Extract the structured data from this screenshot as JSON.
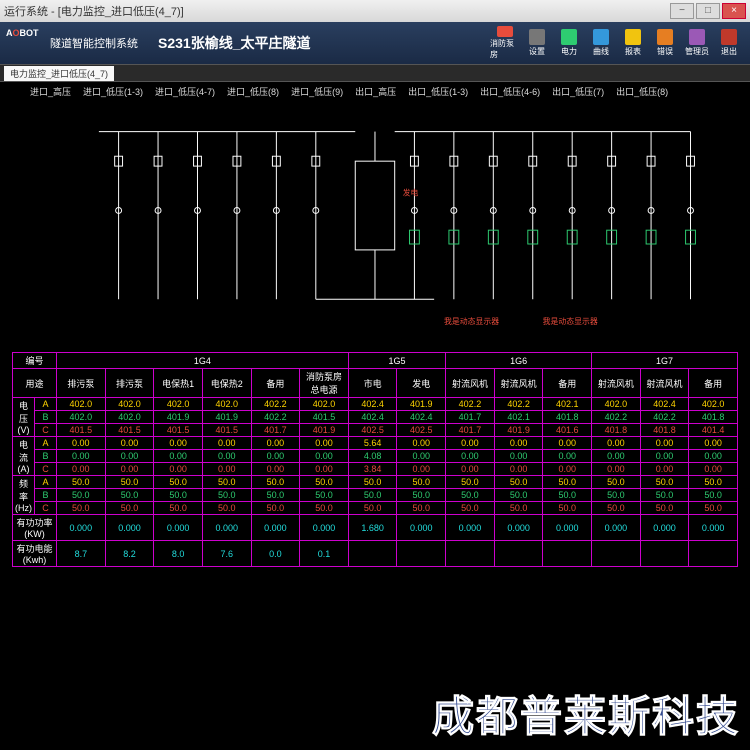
{
  "window": {
    "title": "运行系统 - [电力监控_进口低压(4_7)]"
  },
  "header": {
    "logo1": "A",
    "logoO": "O",
    "logo2": "BOT",
    "sysname": "隧道智能控制系统",
    "linetitle": "S231张榆线_太平庄隧道"
  },
  "toolbar": [
    {
      "lbl": "消防泵房",
      "c": "#e74c3c"
    },
    {
      "lbl": "设置",
      "c": "#777"
    },
    {
      "lbl": "电力",
      "c": "#2ecc71"
    },
    {
      "lbl": "曲线",
      "c": "#3498db"
    },
    {
      "lbl": "报表",
      "c": "#f1c40f"
    },
    {
      "lbl": "错误",
      "c": "#e67e22"
    },
    {
      "lbl": "管理员",
      "c": "#9b59b6"
    },
    {
      "lbl": "退出",
      "c": "#c0392b"
    }
  ],
  "tab": "电力监控_进口低压(4_7)",
  "subtabs": [
    "进口_高压",
    "进口_低压(1-3)",
    "进口_低压(4-7)",
    "进口_低压(8)",
    "进口_低压(9)",
    "出口_高压",
    "出口_低压(1-3)",
    "出口_低压(4-6)",
    "出口_低压(7)",
    "出口_低压(8)"
  ],
  "diagram": {
    "label1": "发电",
    "label2": "我是动态显示器",
    "label3": "我是动态显示器"
  },
  "table": {
    "hdr_id": "编号",
    "hdr_use": "用途",
    "hdr_v": "电压",
    "hdr_v2": "(V)",
    "hdr_i": "电流",
    "hdr_i2": "(A)",
    "hdr_f": "频率",
    "hdr_f2": "(Hz)",
    "hdr_p": "有功功率(KW)",
    "hdr_e": "有功电能(Kwh)",
    "groups": [
      "1G4",
      "1G5",
      "1G6",
      "1G7"
    ],
    "uses": [
      "排污泵",
      "排污泵",
      "电保热1",
      "电保热2",
      "备用",
      "消防泵房总电源",
      "市电",
      "发电",
      "射流风机",
      "射流风机",
      "备用",
      "射流风机",
      "射流风机",
      "备用"
    ],
    "vA": [
      "402.0",
      "402.0",
      "402.0",
      "402.0",
      "402.2",
      "402.0",
      "402.4",
      "401.9",
      "402.2",
      "402.2",
      "402.1",
      "402.0",
      "402.4",
      "402.0"
    ],
    "vB": [
      "402.0",
      "402.0",
      "401.9",
      "401.9",
      "402.2",
      "401.5",
      "402.4",
      "402.4",
      "401.7",
      "402.1",
      "401.8",
      "402.2",
      "402.2",
      "401.8"
    ],
    "vC": [
      "401.5",
      "401.5",
      "401.5",
      "401.5",
      "401.7",
      "401.9",
      "402.5",
      "402.5",
      "401.7",
      "401.9",
      "401.6",
      "401.8",
      "401.8",
      "401.4"
    ],
    "iA": [
      "0.00",
      "0.00",
      "0.00",
      "0.00",
      "0.00",
      "0.00",
      "5.64",
      "0.00",
      "0.00",
      "0.00",
      "0.00",
      "0.00",
      "0.00",
      "0.00"
    ],
    "iB": [
      "0.00",
      "0.00",
      "0.00",
      "0.00",
      "0.00",
      "0.00",
      "4.08",
      "0.00",
      "0.00",
      "0.00",
      "0.00",
      "0.00",
      "0.00",
      "0.00"
    ],
    "iC": [
      "0.00",
      "0.00",
      "0.00",
      "0.00",
      "0.00",
      "0.00",
      "3.84",
      "0.00",
      "0.00",
      "0.00",
      "0.00",
      "0.00",
      "0.00",
      "0.00"
    ],
    "fA": [
      "50.0",
      "50.0",
      "50.0",
      "50.0",
      "50.0",
      "50.0",
      "50.0",
      "50.0",
      "50.0",
      "50.0",
      "50.0",
      "50.0",
      "50.0",
      "50.0"
    ],
    "fB": [
      "50.0",
      "50.0",
      "50.0",
      "50.0",
      "50.0",
      "50.0",
      "50.0",
      "50.0",
      "50.0",
      "50.0",
      "50.0",
      "50.0",
      "50.0",
      "50.0"
    ],
    "fC": [
      "50.0",
      "50.0",
      "50.0",
      "50.0",
      "50.0",
      "50.0",
      "50.0",
      "50.0",
      "50.0",
      "50.0",
      "50.0",
      "50.0",
      "50.0",
      "50.0"
    ],
    "kw": [
      "0.000",
      "0.000",
      "0.000",
      "0.000",
      "0.000",
      "0.000",
      "1.680",
      "0.000",
      "0.000",
      "0.000",
      "0.000",
      "0.000",
      "0.000",
      "0.000"
    ],
    "kwh": [
      "8.7",
      "8.2",
      "8.0",
      "7.6",
      "0.0",
      "0.1",
      "",
      "",
      "",
      "",
      "",
      "",
      "",
      ""
    ]
  },
  "watermark": "成都普莱斯科技"
}
